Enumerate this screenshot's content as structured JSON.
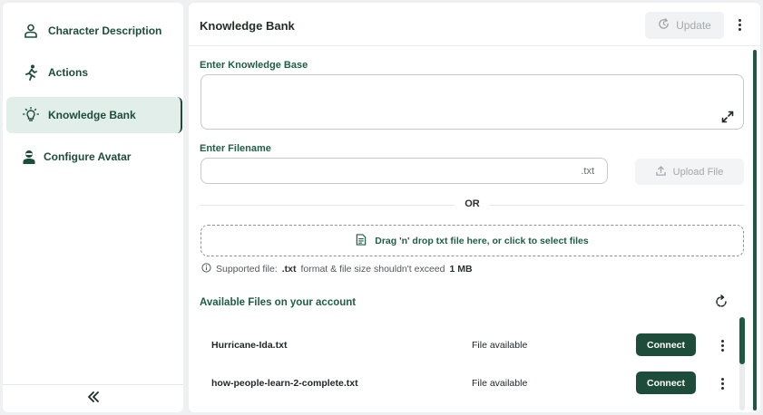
{
  "sidebar": {
    "items": [
      {
        "label": "Character Description",
        "icon": "person-icon",
        "active": false
      },
      {
        "label": "Actions",
        "icon": "running-person-icon",
        "active": false
      },
      {
        "label": "Knowledge Bank",
        "icon": "lightbulb-icon",
        "active": true
      },
      {
        "label": "Configure Avatar",
        "icon": "avatar-icon",
        "active": false
      }
    ],
    "collapse_label": "«"
  },
  "header": {
    "title": "Knowledge Bank",
    "update_label": "Update"
  },
  "form": {
    "knowledge_base_label": "Enter Knowledge Base",
    "knowledge_base_value": "",
    "filename_label": "Enter Filename",
    "filename_value": "",
    "filename_suffix": ".txt",
    "upload_label": "Upload File",
    "or_label": "OR",
    "dropzone_label": "Drag 'n' drop txt file here, or click to select files",
    "supported_prefix": "Supported file:",
    "supported_format": ".txt",
    "supported_middle": "format & file size shouldn't exceed",
    "supported_size": "1 MB"
  },
  "files": {
    "title": "Available Files on your account",
    "rows": [
      {
        "name": "Hurricane-Ida.txt",
        "status": "File available",
        "action": "Connect"
      },
      {
        "name": "how-people-learn-2-complete.txt",
        "status": "File available",
        "action": "Connect"
      }
    ]
  },
  "colors": {
    "brand": "#1d4d3a",
    "accent_text": "#1d5e45",
    "active_bg": "#e2eeea"
  }
}
